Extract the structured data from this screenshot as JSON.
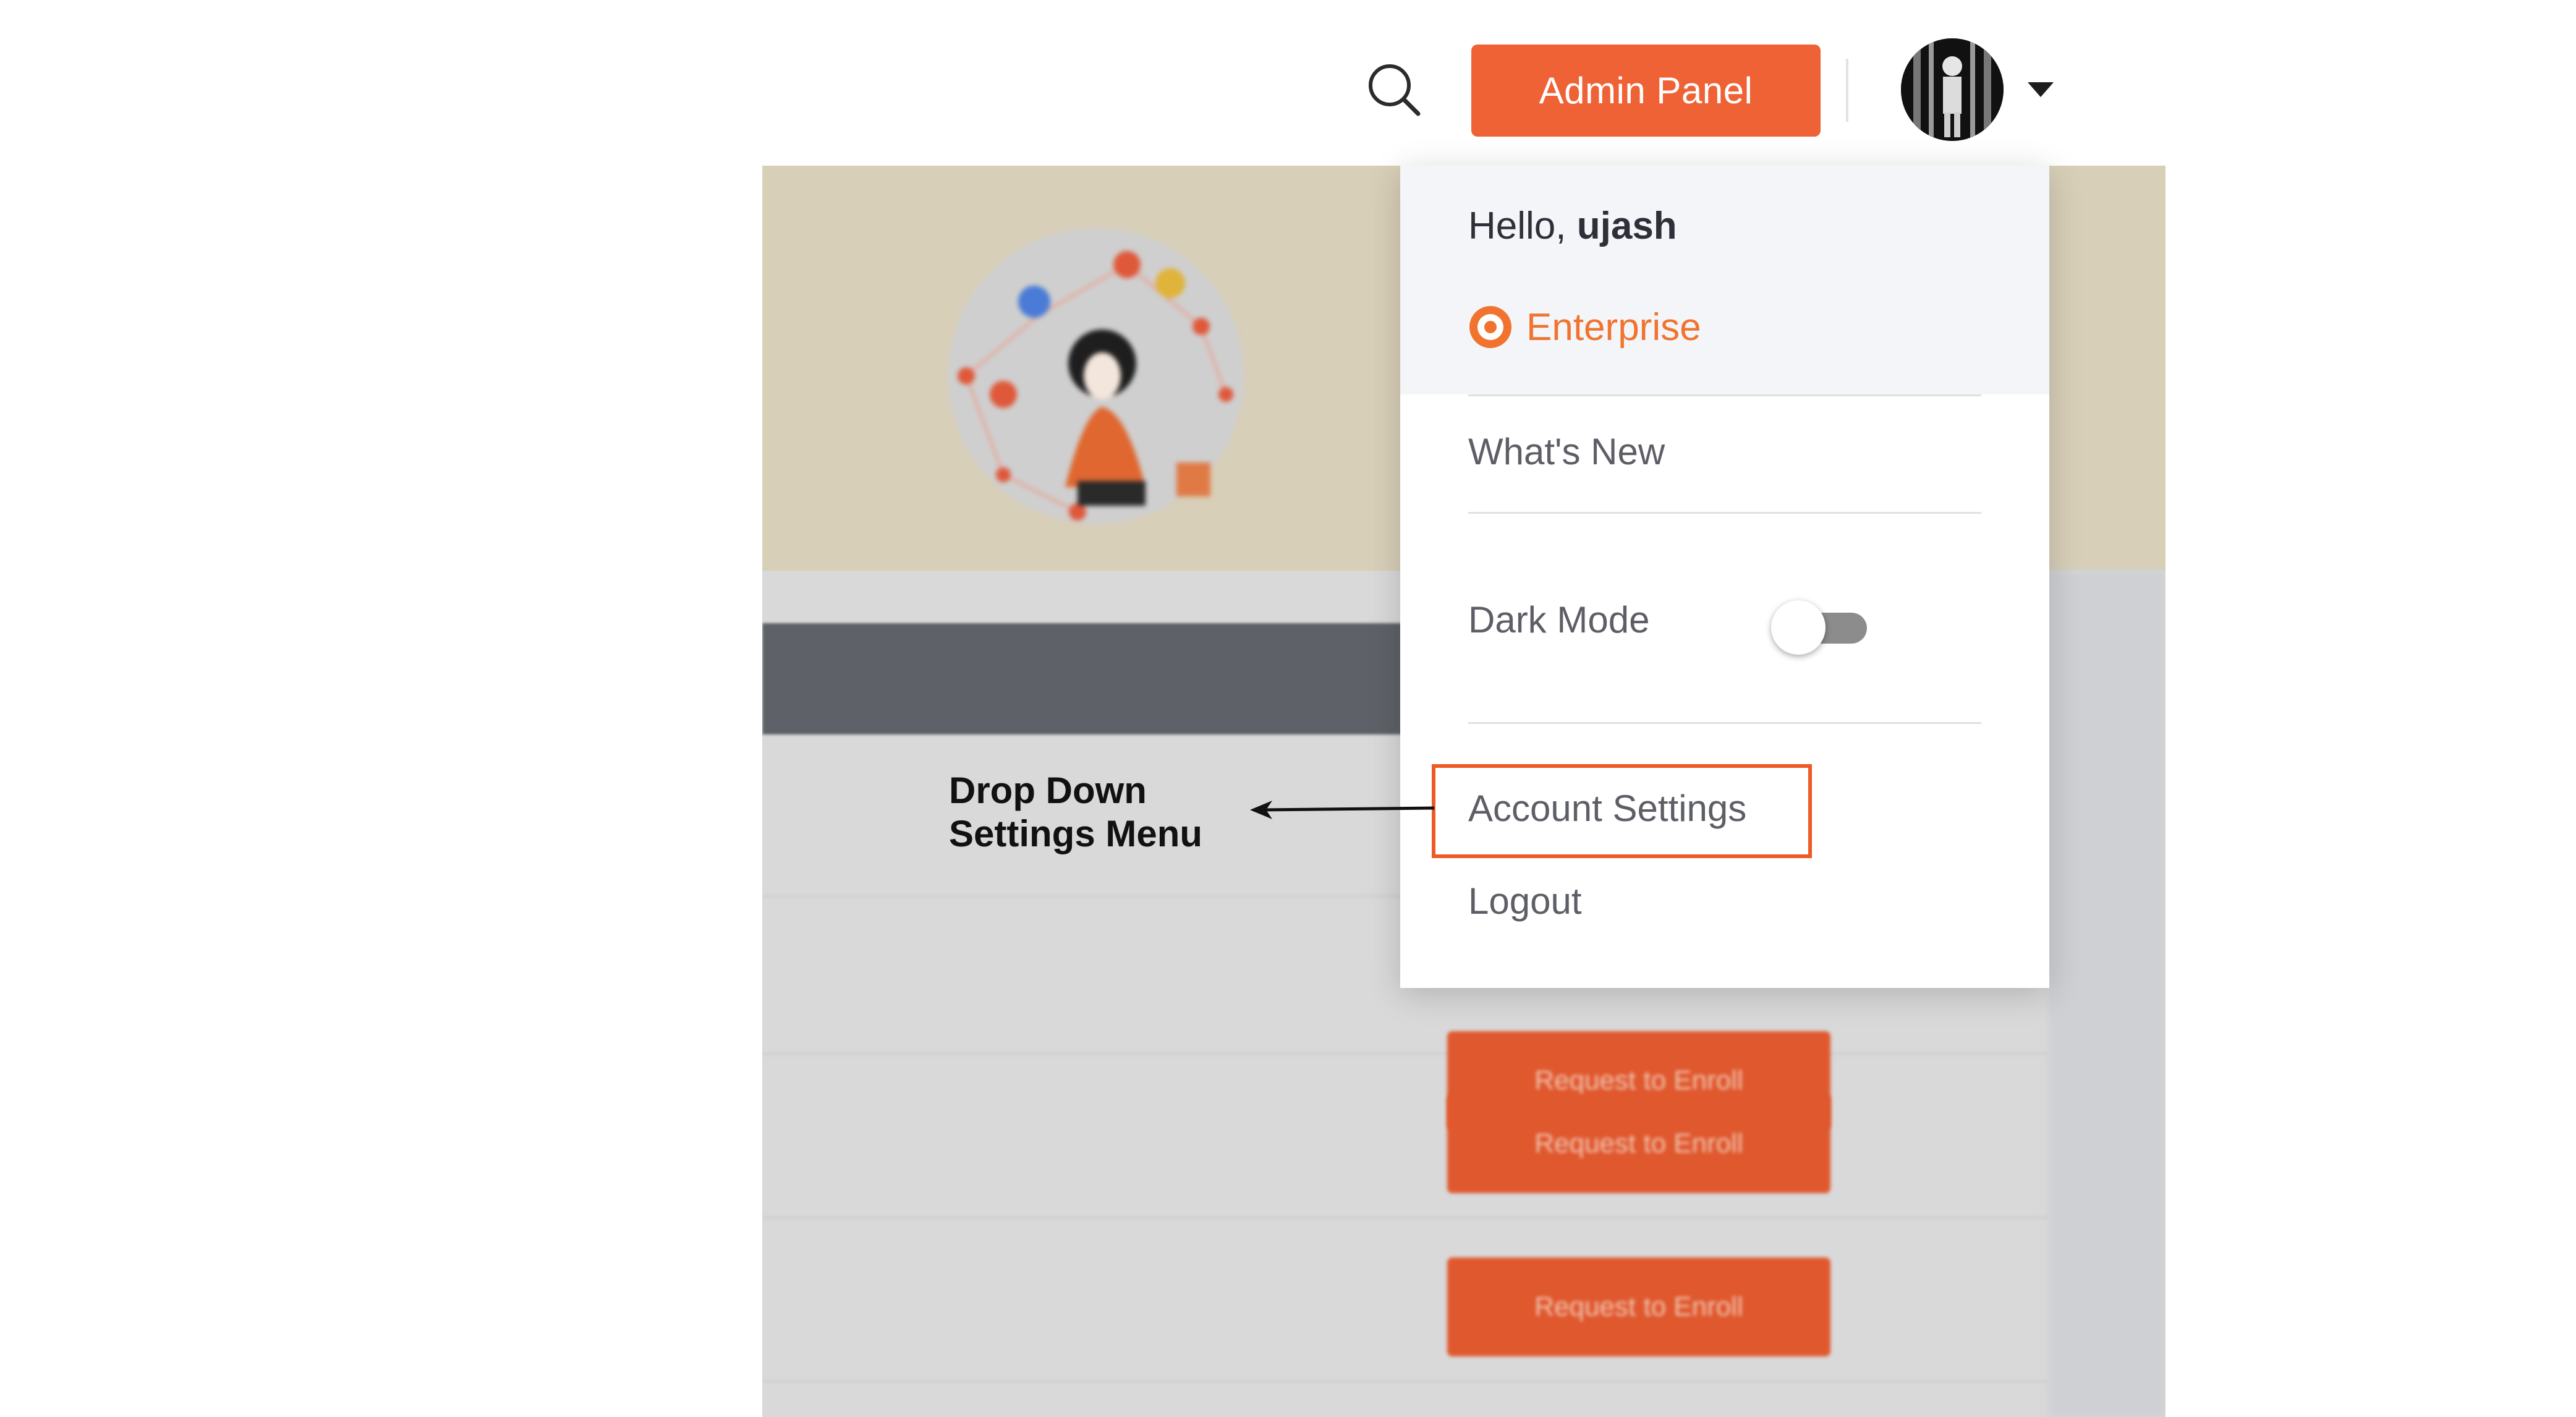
{
  "header": {
    "search_icon": "search-icon",
    "admin_button_label": "Admin Panel",
    "avatar_icon": "user-avatar",
    "caret_icon": "caret-down-icon",
    "accent_color": "#ee6235"
  },
  "dropdown": {
    "greeting_prefix": "Hello,",
    "username": "ujash",
    "plan_icon": "enterprise-badge-icon",
    "plan_label": "Enterprise",
    "plan_color": "#f0742f",
    "items": {
      "whats_new": "What's New",
      "dark_mode": "Dark Mode",
      "dark_mode_enabled": false,
      "account_settings": "Account Settings",
      "logout": "Logout"
    }
  },
  "annotation": {
    "line1": "Drop Down",
    "line2": "Settings Menu",
    "highlight_color": "#ee5a24"
  },
  "background": {
    "enroll_label": "Request to Enroll"
  }
}
